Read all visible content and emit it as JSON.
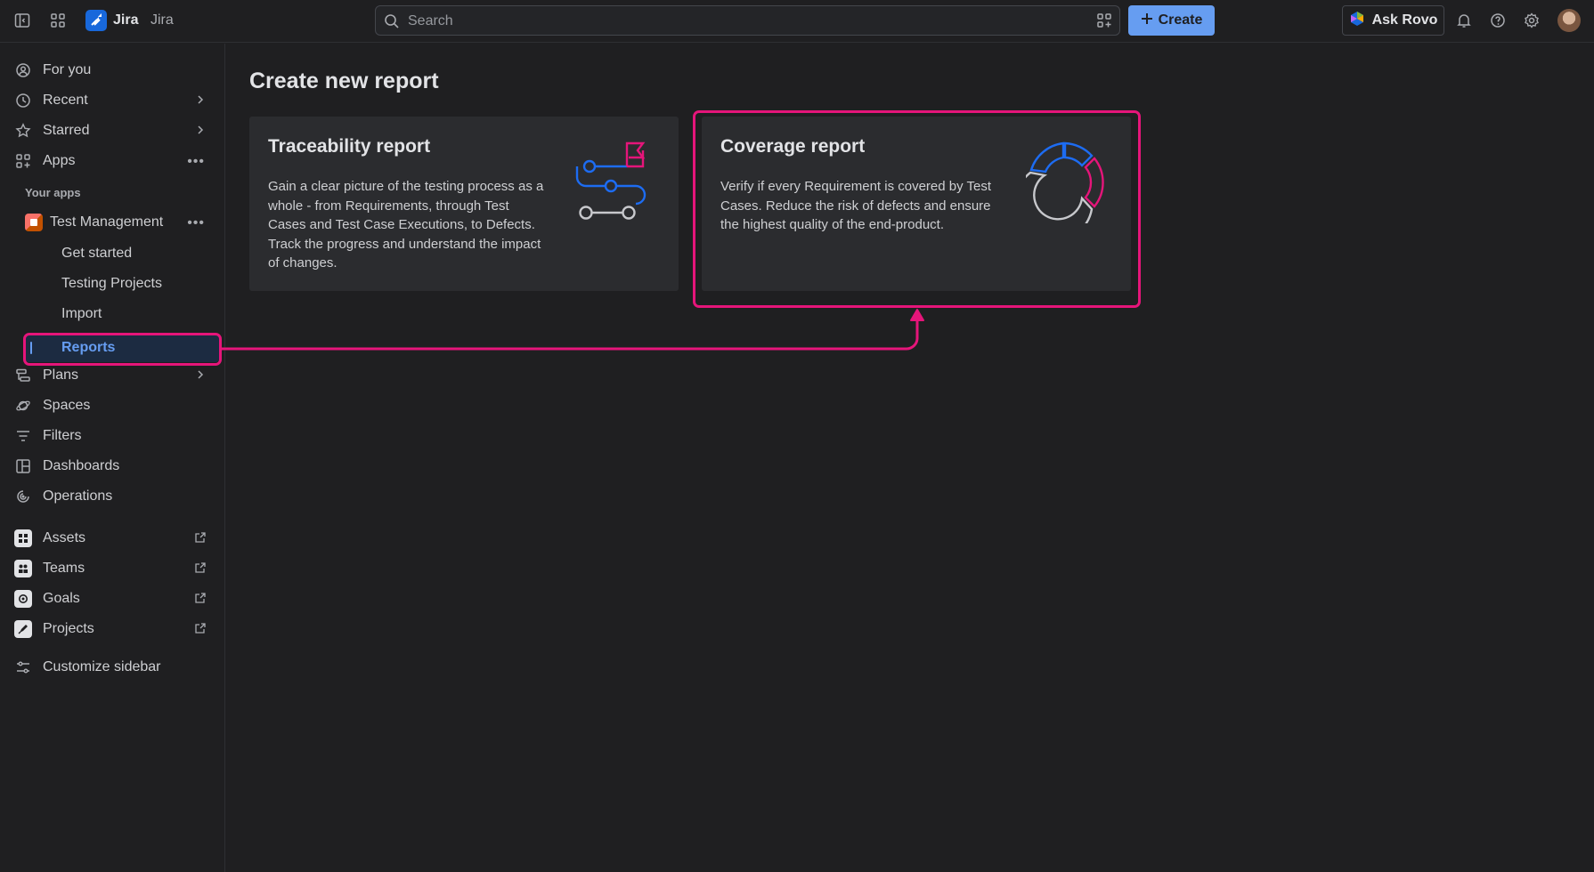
{
  "topbar": {
    "brand": "Jira",
    "brand_sub": "Jira",
    "search_placeholder": "Search",
    "create_label": "Create",
    "rovo_label": "Ask Rovo"
  },
  "sidebar": {
    "items": [
      {
        "label": "For you"
      },
      {
        "label": "Recent"
      },
      {
        "label": "Starred"
      },
      {
        "label": "Apps"
      }
    ],
    "your_apps_label": "Your apps",
    "app": {
      "label": "Test Management",
      "children": [
        "Get started",
        "Testing Projects",
        "Import",
        "Reports"
      ]
    },
    "items2": [
      {
        "label": "Plans"
      },
      {
        "label": "Spaces"
      },
      {
        "label": "Filters"
      },
      {
        "label": "Dashboards"
      },
      {
        "label": "Operations"
      }
    ],
    "external": [
      {
        "label": "Assets"
      },
      {
        "label": "Teams"
      },
      {
        "label": "Goals"
      },
      {
        "label": "Projects"
      }
    ],
    "customize_label": "Customize sidebar"
  },
  "main": {
    "title": "Create new report",
    "cards": [
      {
        "title": "Traceability report",
        "description": "Gain a clear picture of the testing process as a whole - from Requirements, through Test Cases and Test Case Executions, to Defects. Track the progress and understand the impact of changes."
      },
      {
        "title": "Coverage report",
        "description": "Verify if every Requirement is covered by Test Cases. Reduce the risk of defects and ensure the highest quality of the end-product."
      }
    ]
  },
  "colors": {
    "accent": "#669df1",
    "highlight": "#e5157a",
    "background": "#1f1f21",
    "card": "#2b2c2f"
  }
}
